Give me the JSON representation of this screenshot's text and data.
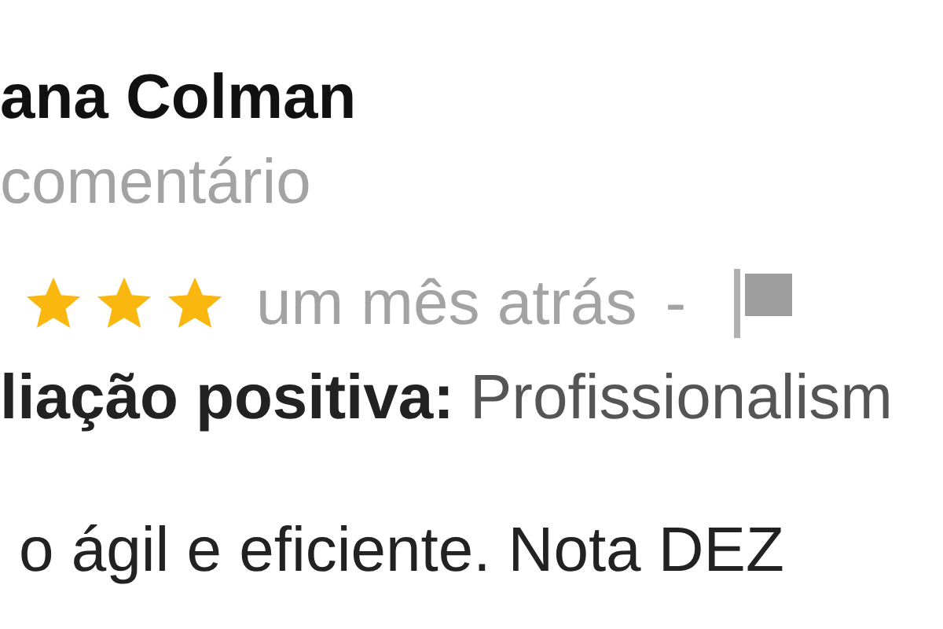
{
  "reviewer": {
    "name": "ana Colman",
    "subtitle": "comentário"
  },
  "rating": {
    "stars": 3,
    "time": "um mês atrás",
    "separator": "-"
  },
  "positive": {
    "label": "liação positiva:",
    "value": "Profissionalism"
  },
  "text": "o ágil e eficiente. Nota DEZ"
}
